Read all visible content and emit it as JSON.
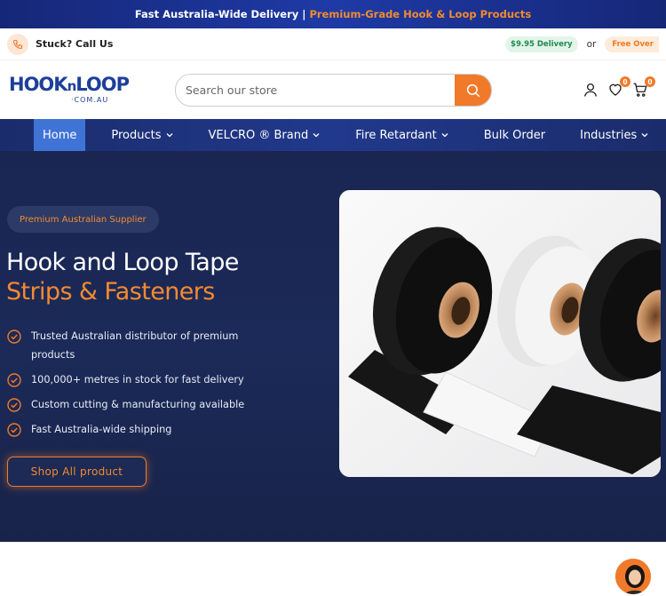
{
  "announcement": {
    "part1": "Fast Australia-Wide Delivery |",
    "part2": "Premium-Grade Hook & Loop Products"
  },
  "topbar": {
    "stuck": "Stuck? Call Us",
    "delivery": "$9.95 Delivery",
    "or": "or",
    "free": "Free Over"
  },
  "logo": {
    "main_left": "HOOK",
    "main_n": "n",
    "main_right": "LOOP",
    "sub": "·COM.AU"
  },
  "search": {
    "placeholder": "Search our store"
  },
  "icons": {
    "wishlist_count": "0",
    "cart_count": "0"
  },
  "nav": {
    "home": "Home",
    "products": "Products",
    "velcro": "VELCRO ® Brand",
    "fire": "Fire Retardant",
    "bulk": "Bulk Order",
    "industries": "Industries"
  },
  "hero": {
    "badge": "Premium Australian Supplier",
    "title_line1": "Hook and Loop Tape",
    "title_line2": "Strips & Fasteners",
    "features": [
      "Trusted Australian distributor of premium products",
      "100,000+ metres in stock for fast delivery",
      "Custom cutting & manufacturing available",
      "Fast Australia-wide shipping"
    ],
    "cta": "Shop All product"
  },
  "colors": {
    "brand_blue": "#1e3f9a",
    "accent_orange": "#f07a2a",
    "hero_bg": "#1a2552",
    "nav_active": "#3f74d6"
  }
}
